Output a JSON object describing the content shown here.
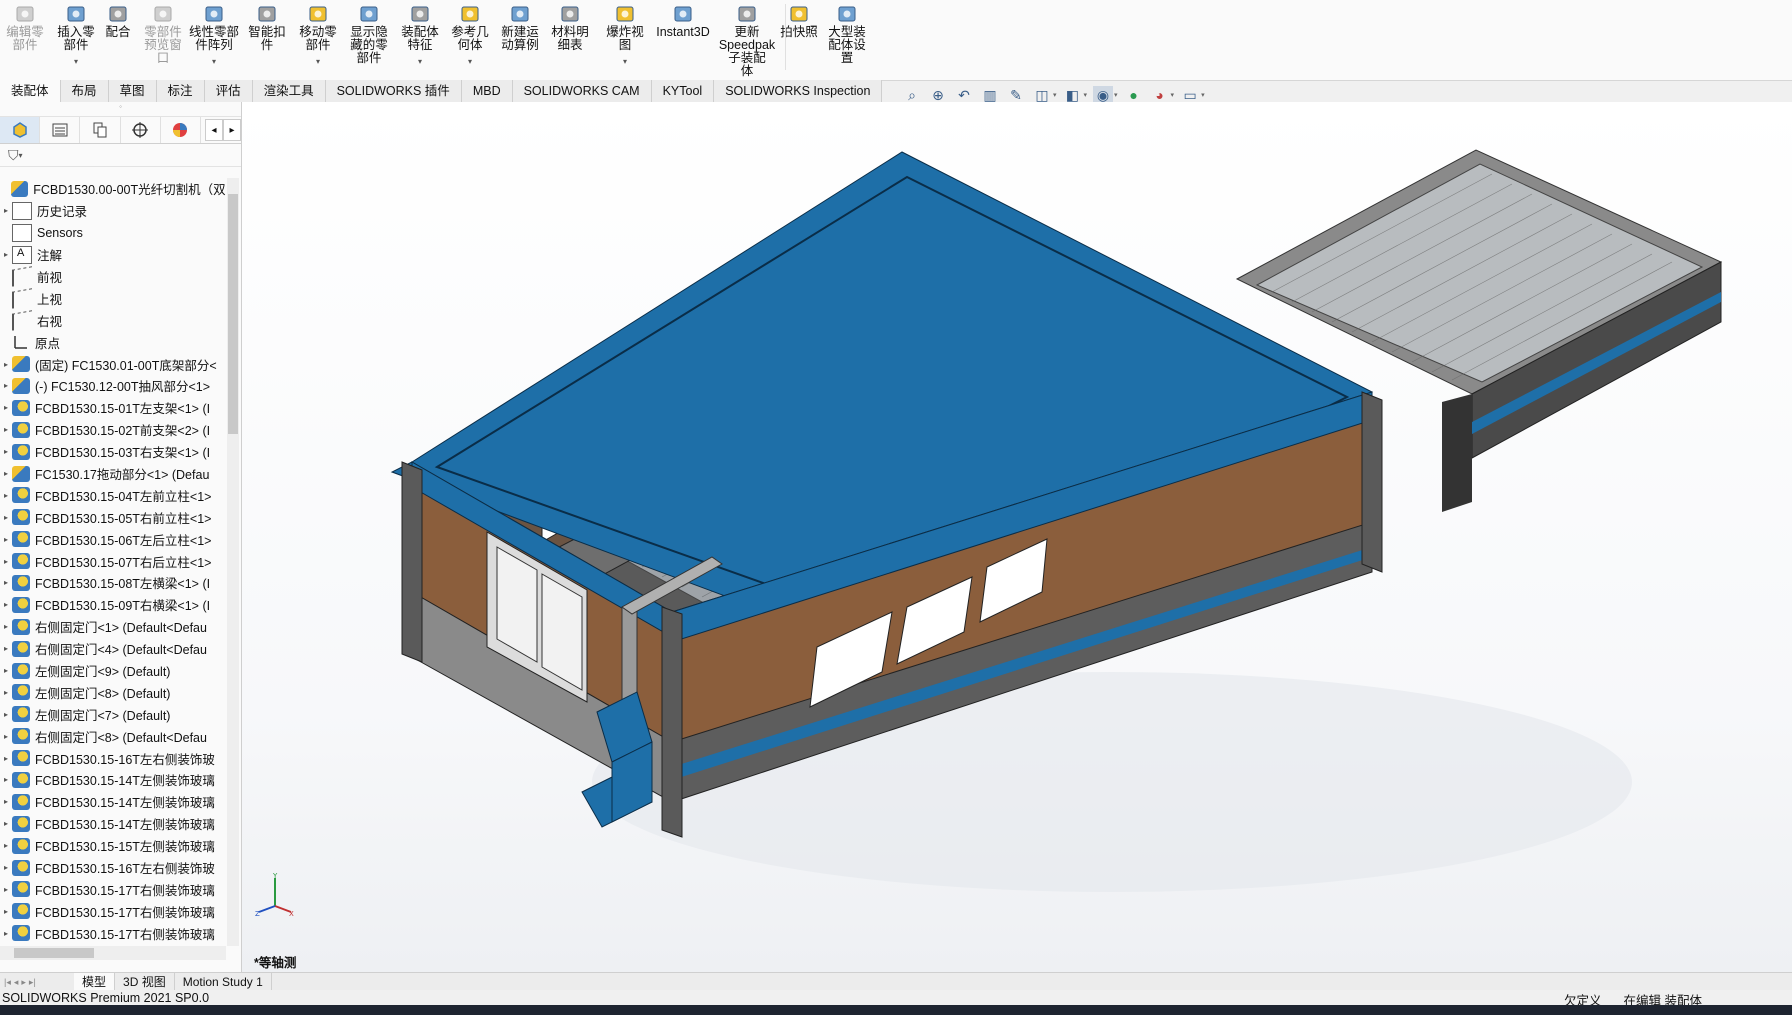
{
  "ribbon": {
    "buttons": [
      {
        "id": "edit-component",
        "label": "编辑零\n部件",
        "disabled": true
      },
      {
        "id": "insert-component",
        "label": "插入零\n部件",
        "dropdown": true
      },
      {
        "id": "mate",
        "label": "配合"
      },
      {
        "id": "component-preview",
        "label": "零部件\n预览窗\n口",
        "disabled": true
      },
      {
        "id": "linear-pattern",
        "label": "线性零部\n件阵列",
        "dropdown": true
      },
      {
        "id": "smart-fasteners",
        "label": "智能扣\n件"
      },
      {
        "id": "move-component",
        "label": "移动零\n部件",
        "dropdown": true
      },
      {
        "id": "show-hidden",
        "label": "显示隐\n藏的零\n部件"
      },
      {
        "id": "assembly-features",
        "label": "装配体\n特征",
        "dropdown": true
      },
      {
        "id": "reference-geometry",
        "label": "参考几\n何体",
        "dropdown": true
      },
      {
        "id": "new-motion-study",
        "label": "新建运\n动算例"
      },
      {
        "id": "bom",
        "label": "材料明\n细表"
      },
      {
        "id": "exploded-view",
        "label": "爆炸视\n图",
        "dropdown": true
      },
      {
        "id": "instant3d",
        "label": "Instant3D"
      },
      {
        "id": "speedpak",
        "label": "更新\nSpeedpak\n子装配\n体"
      },
      {
        "id": "snapshot",
        "label": "拍快照"
      },
      {
        "id": "large-assembly",
        "label": "大型装\n配体设\n置"
      }
    ]
  },
  "tabs": [
    "装配体",
    "布局",
    "草图",
    "标注",
    "评估",
    "渲染工具",
    "SOLIDWORKS 插件",
    "MBD",
    "SOLIDWORKS CAM",
    "KYTool",
    "SOLIDWORKS Inspection"
  ],
  "active_tab": "装配体",
  "tree": {
    "root": "FCBD1530.00-00T光纤切割机（双齿",
    "nodes": [
      {
        "label": "历史记录",
        "icon": "history",
        "expand": true
      },
      {
        "label": "Sensors",
        "icon": "sensor",
        "expand": false
      },
      {
        "label": "注解",
        "icon": "annotation",
        "expand": true
      },
      {
        "label": "前视",
        "icon": "plane",
        "expand": false
      },
      {
        "label": "上视",
        "icon": "plane",
        "expand": false
      },
      {
        "label": "右视",
        "icon": "plane",
        "expand": false
      },
      {
        "label": "原点",
        "icon": "origin",
        "expand": false
      },
      {
        "label": "(固定) FC1530.01-00T底架部分<",
        "icon": "asm",
        "expand": true
      },
      {
        "label": "(-) FC1530.12-00T抽风部分<1>",
        "icon": "asm",
        "expand": true
      },
      {
        "label": "FCBD1530.15-01T左支架<1> (I",
        "icon": "asm2",
        "expand": true
      },
      {
        "label": "FCBD1530.15-02T前支架<2> (I",
        "icon": "asm2",
        "expand": true
      },
      {
        "label": "FCBD1530.15-03T右支架<1> (I",
        "icon": "asm2",
        "expand": true
      },
      {
        "label": "FC1530.17拖动部分<1> (Defau",
        "icon": "asm",
        "expand": true
      },
      {
        "label": "FCBD1530.15-04T左前立柱<1>",
        "icon": "asm2",
        "expand": true
      },
      {
        "label": "FCBD1530.15-05T右前立柱<1>",
        "icon": "asm2",
        "expand": true
      },
      {
        "label": "FCBD1530.15-06T左后立柱<1>",
        "icon": "asm2",
        "expand": true
      },
      {
        "label": "FCBD1530.15-07T右后立柱<1>",
        "icon": "asm2",
        "expand": true
      },
      {
        "label": "FCBD1530.15-08T左横梁<1> (I",
        "icon": "asm2",
        "expand": true
      },
      {
        "label": "FCBD1530.15-09T右横梁<1> (I",
        "icon": "asm2",
        "expand": true
      },
      {
        "label": "右侧固定门<1> (Default<Defau",
        "icon": "asm2",
        "expand": true
      },
      {
        "label": "右侧固定门<4> (Default<Defau",
        "icon": "asm2",
        "expand": true
      },
      {
        "label": "左侧固定门<9> (Default)",
        "icon": "asm2",
        "expand": true
      },
      {
        "label": "左侧固定门<8> (Default)",
        "icon": "asm2",
        "expand": true
      },
      {
        "label": "左侧固定门<7> (Default)",
        "icon": "asm2",
        "expand": true
      },
      {
        "label": "右侧固定门<8> (Default<Defau",
        "icon": "asm2",
        "expand": true
      },
      {
        "label": "FCBD1530.15-16T左右侧装饰玻",
        "icon": "asm2",
        "expand": true
      },
      {
        "label": "FCBD1530.15-14T左侧装饰玻璃",
        "icon": "asm2",
        "expand": true
      },
      {
        "label": "FCBD1530.15-14T左侧装饰玻璃",
        "icon": "asm2",
        "expand": true
      },
      {
        "label": "FCBD1530.15-14T左侧装饰玻璃",
        "icon": "asm2",
        "expand": true
      },
      {
        "label": "FCBD1530.15-15T左侧装饰玻璃",
        "icon": "asm2",
        "expand": true
      },
      {
        "label": "FCBD1530.15-16T左右侧装饰玻",
        "icon": "asm2",
        "expand": true
      },
      {
        "label": "FCBD1530.15-17T右侧装饰玻璃",
        "icon": "asm2",
        "expand": true
      },
      {
        "label": "FCBD1530.15-17T右侧装饰玻璃",
        "icon": "asm2",
        "expand": true
      },
      {
        "label": "FCBD1530.15-17T右侧装饰玻璃",
        "icon": "asm2",
        "expand": true
      }
    ]
  },
  "viewport": {
    "view_name": "*等轴测"
  },
  "bottom_tabs": [
    "模型",
    "3D 视图",
    "Motion Study 1"
  ],
  "active_bottom_tab": "模型",
  "status": {
    "product": "SOLIDWORKS Premium 2021 SP0.0",
    "definition": "欠定义",
    "mode": "在编辑 装配体"
  },
  "colors": {
    "frame_blue": "#1e6fa8",
    "panel_brown": "#8b5e3c",
    "panel_grey": "#6f6f6f",
    "accent": "#3a7abf"
  }
}
